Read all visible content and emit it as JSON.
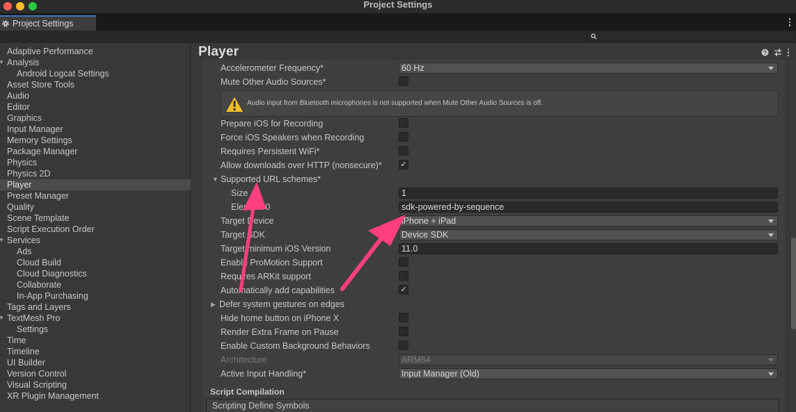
{
  "window": {
    "title": "Project Settings",
    "traffic_lights": [
      "#ff5f57",
      "#febc2e",
      "#28c840"
    ]
  },
  "tab": {
    "label": "Project Settings",
    "icon": "gear-icon"
  },
  "search": {
    "placeholder": "",
    "icon": "search-icon"
  },
  "sidebar": {
    "items": [
      {
        "label": "Adaptive Performance"
      },
      {
        "label": "Analysis",
        "expanded": true
      },
      {
        "label": "Android Logcat Settings",
        "child": true
      },
      {
        "label": "Asset Store Tools"
      },
      {
        "label": "Audio"
      },
      {
        "label": "Editor"
      },
      {
        "label": "Graphics"
      },
      {
        "label": "Input Manager"
      },
      {
        "label": "Memory Settings"
      },
      {
        "label": "Package Manager"
      },
      {
        "label": "Physics"
      },
      {
        "label": "Physics 2D"
      },
      {
        "label": "Player",
        "selected": true
      },
      {
        "label": "Preset Manager"
      },
      {
        "label": "Quality"
      },
      {
        "label": "Scene Template"
      },
      {
        "label": "Script Execution Order"
      },
      {
        "label": "Services",
        "expanded": true
      },
      {
        "label": "Ads",
        "child": true
      },
      {
        "label": "Cloud Build",
        "child": true
      },
      {
        "label": "Cloud Diagnostics",
        "child": true
      },
      {
        "label": "Collaborate",
        "child": true
      },
      {
        "label": "In-App Purchasing",
        "child": true
      },
      {
        "label": "Tags and Layers"
      },
      {
        "label": "TextMesh Pro",
        "expanded": true
      },
      {
        "label": "Settings",
        "child": true
      },
      {
        "label": "Time"
      },
      {
        "label": "Timeline"
      },
      {
        "label": "UI Builder"
      },
      {
        "label": "Version Control"
      },
      {
        "label": "Visual Scripting"
      },
      {
        "label": "XR Plugin Management"
      }
    ]
  },
  "main": {
    "title": "Player",
    "header_icons": [
      "help-icon",
      "preset-sliders-icon",
      "kebab-menu-icon"
    ],
    "warning": {
      "icon": "warning-icon",
      "text": "Audio input from Bluetooth microphones is not supported when Mute Other Audio Sources is off."
    },
    "rows": {
      "accelerometer": {
        "label": "Accelerometer Frequency*",
        "value": "60 Hz"
      },
      "mute_audio": {
        "label": "Mute Other Audio Sources*",
        "checked": false
      },
      "prepare_ios": {
        "label": "Prepare iOS for Recording",
        "checked": false
      },
      "force_speakers": {
        "label": "Force iOS Speakers when Recording",
        "checked": false
      },
      "persistent_wifi": {
        "label": "Requires Persistent WiFi*",
        "checked": false
      },
      "allow_http": {
        "label": "Allow downloads over HTTP (nonsecure)*",
        "checked": true,
        "check_glyph": "✓"
      },
      "url_schemes": {
        "label": "Supported URL schemes*",
        "expanded": true
      },
      "size": {
        "label": "Size",
        "value": "1"
      },
      "element0": {
        "label": "Element 0",
        "value": "sdk-powered-by-sequence"
      },
      "target_device": {
        "label": "Target Device",
        "value": "iPhone + iPad"
      },
      "target_sdk": {
        "label": "Target SDK",
        "value": "Device SDK"
      },
      "min_ios": {
        "label": "Target minimum iOS Version",
        "value": "11.0"
      },
      "promotion": {
        "label": "Enable ProMotion Support",
        "checked": false
      },
      "arkit": {
        "label": "Requires ARKit support",
        "checked": false
      },
      "auto_caps": {
        "label": "Automatically add capabilities",
        "checked": true,
        "check_glyph": "✓"
      },
      "defer_gestures": {
        "label": "Defer system gestures on edges",
        "expanded": false
      },
      "hide_home": {
        "label": "Hide home button on iPhone X",
        "checked": false
      },
      "extra_frame": {
        "label": "Render Extra Frame on Pause",
        "checked": false
      },
      "custom_bg": {
        "label": "Enable Custom Background Behaviors",
        "checked": false
      },
      "architecture": {
        "label": "Architecture",
        "value": "ARM64",
        "disabled": true
      },
      "input_handling": {
        "label": "Active Input Handling*",
        "value": "Input Manager (Old)"
      }
    },
    "script_compilation": {
      "title": "Script Compilation",
      "define_symbols": "Scripting Define Symbols"
    }
  },
  "annotation": {
    "arrow_color": "#ff3f7f",
    "arrow_count": 2
  }
}
